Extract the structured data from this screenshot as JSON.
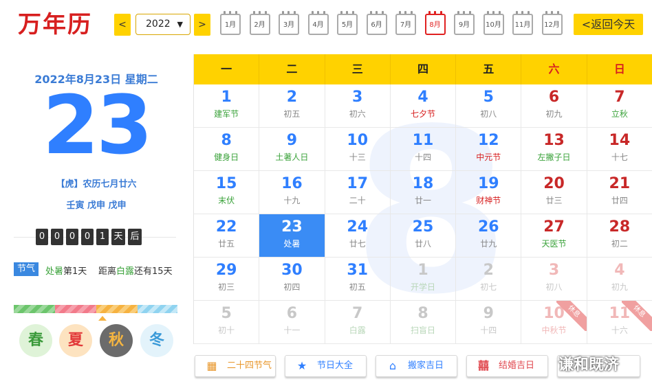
{
  "brand": "万年历",
  "header": {
    "prev": "<",
    "next": ">",
    "year": "2022",
    "months": [
      "1月",
      "2月",
      "3月",
      "4月",
      "5月",
      "6月",
      "7月",
      "8月",
      "9月",
      "10月",
      "11月",
      "12月"
    ],
    "active_month": "8月",
    "today_button": "<返回今天"
  },
  "left": {
    "date_line": "2022年8月23日 星期二",
    "big_day": "23",
    "lunar": "【虎】农历七月廿六",
    "ganzhi": "壬寅 戊申 戊申",
    "countdown_digits": [
      "0",
      "0",
      "0",
      "0",
      "1"
    ],
    "countdown_unit1": "天",
    "countdown_unit2": "后",
    "jieqi_tag": "节气",
    "jieqi_text1_a": "处暑",
    "jieqi_text1_b": "第1天",
    "jieqi_text2_a": "距离",
    "jieqi_text2_b": "白露",
    "jieqi_text2_c": "还有15天",
    "seasons": [
      "春",
      "夏",
      "秋",
      "冬"
    ]
  },
  "calendar": {
    "watermark": "8",
    "weekdays": [
      "一",
      "二",
      "三",
      "四",
      "五",
      "六",
      "日"
    ],
    "days": [
      {
        "n": "1",
        "s": "建军节"
      },
      {
        "n": "2",
        "s": "初五"
      },
      {
        "n": "3",
        "s": "初六"
      },
      {
        "n": "4",
        "s": "七夕节"
      },
      {
        "n": "5",
        "s": "初八"
      },
      {
        "n": "6",
        "s": "初九"
      },
      {
        "n": "7",
        "s": "立秋"
      },
      {
        "n": "8",
        "s": "健身日"
      },
      {
        "n": "9",
        "s": "土著人日"
      },
      {
        "n": "10",
        "s": "十三"
      },
      {
        "n": "11",
        "s": "十四"
      },
      {
        "n": "12",
        "s": "中元节"
      },
      {
        "n": "13",
        "s": "左撇子日"
      },
      {
        "n": "14",
        "s": "十七"
      },
      {
        "n": "15",
        "s": "末伏"
      },
      {
        "n": "16",
        "s": "十九"
      },
      {
        "n": "17",
        "s": "二十"
      },
      {
        "n": "18",
        "s": "廿一"
      },
      {
        "n": "19",
        "s": "财神节"
      },
      {
        "n": "20",
        "s": "廿三"
      },
      {
        "n": "21",
        "s": "廿四"
      },
      {
        "n": "22",
        "s": "廿五"
      },
      {
        "n": "23",
        "s": "处暑"
      },
      {
        "n": "24",
        "s": "廿七"
      },
      {
        "n": "25",
        "s": "廿八"
      },
      {
        "n": "26",
        "s": "廿九"
      },
      {
        "n": "27",
        "s": "天医节"
      },
      {
        "n": "28",
        "s": "初二"
      },
      {
        "n": "29",
        "s": "初三"
      },
      {
        "n": "30",
        "s": "初四"
      },
      {
        "n": "31",
        "s": "初五"
      },
      {
        "n": "1",
        "s": "开学日"
      },
      {
        "n": "2",
        "s": "初七"
      },
      {
        "n": "3",
        "s": "初八"
      },
      {
        "n": "4",
        "s": "初九"
      },
      {
        "n": "5",
        "s": "初十"
      },
      {
        "n": "6",
        "s": "十一"
      },
      {
        "n": "7",
        "s": "白露"
      },
      {
        "n": "8",
        "s": "扫盲日"
      },
      {
        "n": "9",
        "s": "十四"
      },
      {
        "n": "10",
        "s": "中秋节"
      },
      {
        "n": "11",
        "s": "十六"
      }
    ],
    "rest_label": "休息"
  },
  "buttons": [
    {
      "label": "二十四节气",
      "icon": "calendar-icon"
    },
    {
      "label": "节日大全",
      "icon": "star-icon"
    },
    {
      "label": "搬家吉日",
      "icon": "house-icon"
    },
    {
      "label": "结婚吉日",
      "icon": "double-happiness-icon"
    }
  ],
  "overlay_text": "谦和既济",
  "colors": {
    "accent": "#ffd200",
    "brand": "#d71f1f",
    "blue": "#2f7fff",
    "selected": "#3a8cf5"
  }
}
